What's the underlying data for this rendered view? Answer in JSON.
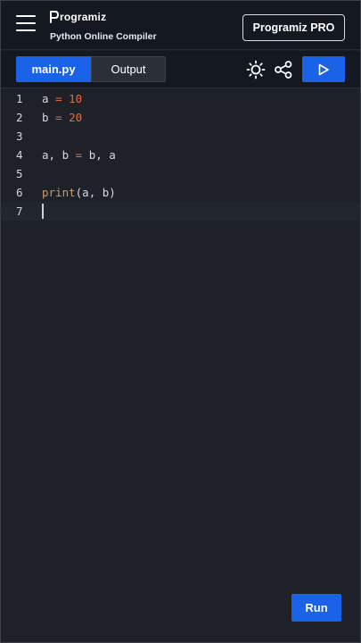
{
  "header": {
    "brand_name": "rogramiz",
    "brand_subtitle": "Python Online Compiler",
    "pro_button_label": "Programiz PRO"
  },
  "toolbar": {
    "tabs": [
      {
        "label": "main.py",
        "active": true
      },
      {
        "label": "Output",
        "active": false
      }
    ],
    "icons": [
      "sun-icon",
      "share-icon",
      "play-icon"
    ]
  },
  "editor": {
    "lines": [
      {
        "number": "1",
        "text": "a = 10"
      },
      {
        "number": "2",
        "text": "b = 20"
      },
      {
        "number": "3",
        "text": ""
      },
      {
        "number": "4",
        "text": "a, b = b, a"
      },
      {
        "number": "5",
        "text": ""
      },
      {
        "number": "6",
        "text": "print(a, b)"
      },
      {
        "number": "7",
        "text": ""
      }
    ],
    "active_line": 7
  },
  "run_button_label": "Run",
  "colors": {
    "accent": "#1a63e8",
    "background": "#1e2127",
    "header": "#141820",
    "number_literal": "#e06c4a",
    "function_name": "#d19a66"
  }
}
